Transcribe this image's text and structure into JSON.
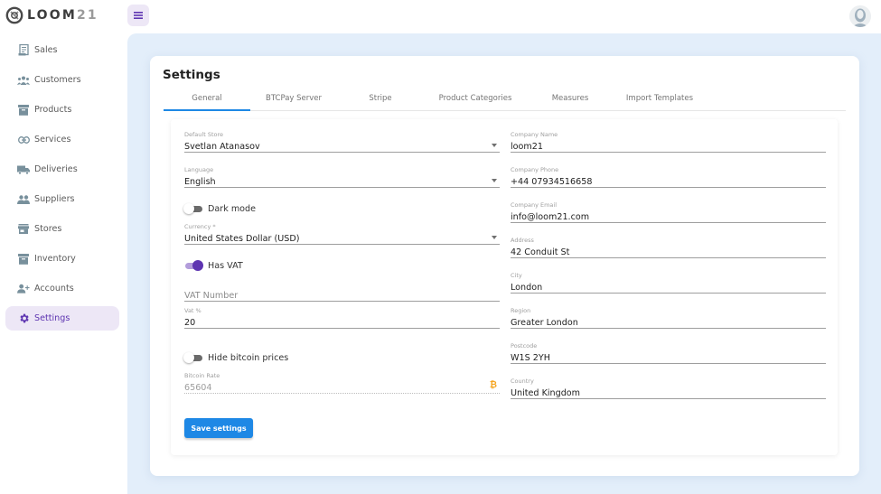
{
  "brand": {
    "name_letters": "LOOM",
    "name_number": "21"
  },
  "sidebar": {
    "items": [
      {
        "label": "Sales",
        "icon": "receipt-icon",
        "active": false
      },
      {
        "label": "Customers",
        "icon": "people-icon",
        "active": false
      },
      {
        "label": "Products",
        "icon": "archive-box-icon",
        "active": false
      },
      {
        "label": "Services",
        "icon": "link-icon",
        "active": false
      },
      {
        "label": "Deliveries",
        "icon": "truck-icon",
        "active": false
      },
      {
        "label": "Suppliers",
        "icon": "group-icon",
        "active": false
      },
      {
        "label": "Stores",
        "icon": "store-icon",
        "active": false
      },
      {
        "label": "Inventory",
        "icon": "archive-box-icon",
        "active": false
      },
      {
        "label": "Accounts",
        "icon": "person-add-icon",
        "active": false
      },
      {
        "label": "Settings",
        "icon": "gear-icon",
        "active": true
      }
    ]
  },
  "page": {
    "title": "Settings",
    "tabs": [
      {
        "label": "General",
        "active": true
      },
      {
        "label": "BTCPay Server",
        "active": false
      },
      {
        "label": "Stripe",
        "active": false
      },
      {
        "label": "Product Categories",
        "active": false
      },
      {
        "label": "Measures",
        "active": false
      },
      {
        "label": "Import Templates",
        "active": false
      }
    ]
  },
  "form": {
    "default_store": {
      "label": "Default Store",
      "value": "Svetlan Atanasov"
    },
    "language": {
      "label": "Language",
      "value": "English"
    },
    "dark_mode": {
      "label": "Dark mode",
      "on": false
    },
    "currency": {
      "label": "Currency *",
      "value": "United States Dollar (USD)"
    },
    "has_vat": {
      "label": "Has VAT",
      "on": true
    },
    "vat_number": {
      "placeholder": "VAT Number",
      "value": ""
    },
    "vat_percent": {
      "label": "Vat %",
      "value": "20"
    },
    "hide_bitcoin": {
      "label": "Hide bitcoin prices",
      "on": false
    },
    "bitcoin_rate": {
      "label": "Bitcoin Rate",
      "value": "65604",
      "icon": "bitcoin-icon",
      "icon_glyph": "₿"
    },
    "company_name": {
      "label": "Company Name",
      "value": "loom21"
    },
    "company_phone": {
      "label": "Company Phone",
      "value": "+44 07934516658"
    },
    "company_email": {
      "label": "Company Email",
      "value": "info@loom21.com"
    },
    "address": {
      "label": "Address",
      "value": "42 Conduit St"
    },
    "city": {
      "label": "City",
      "value": "London"
    },
    "region": {
      "label": "Region",
      "value": "Greater London"
    },
    "postcode": {
      "label": "Postcode",
      "value": "W1S 2YH"
    },
    "country": {
      "label": "Country",
      "value": "United Kingdom"
    },
    "save_label": "Save settings"
  },
  "colors": {
    "accent_purple": "#5e35b1",
    "accent_blue": "#1e88e5",
    "background_blue": "#e3eefa",
    "bitcoin_orange": "#f5a623"
  }
}
